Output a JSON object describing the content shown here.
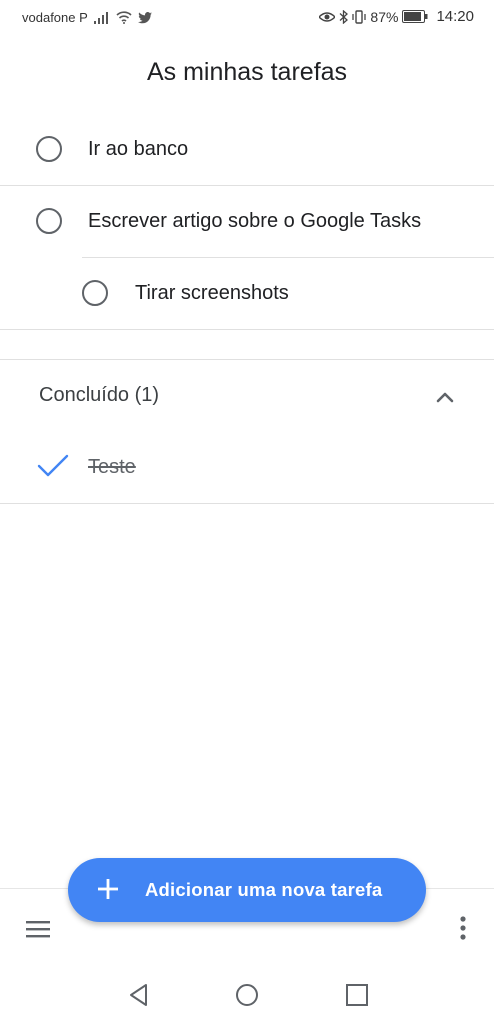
{
  "status_bar": {
    "carrier": "vodafone P",
    "battery": "87%",
    "time": "14:20"
  },
  "title": "As minhas tarefas",
  "tasks": [
    {
      "label": "Ir ao banco"
    },
    {
      "label": "Escrever artigo sobre o Google Tasks"
    },
    {
      "label": "Tirar screenshots",
      "subtask": true
    }
  ],
  "completed": {
    "header": "Concluído (1)",
    "items": [
      {
        "label": "Teste"
      }
    ]
  },
  "fab": {
    "label": "Adicionar uma nova tarefa"
  },
  "icons": {
    "signal": "signal-icon",
    "wifi": "wifi-icon",
    "twitter": "twitter-icon",
    "eye": "eye-icon",
    "bluetooth": "bluetooth-icon",
    "vibrate": "vibrate-icon",
    "battery": "battery-icon"
  },
  "colors": {
    "accent": "#4285f4"
  }
}
